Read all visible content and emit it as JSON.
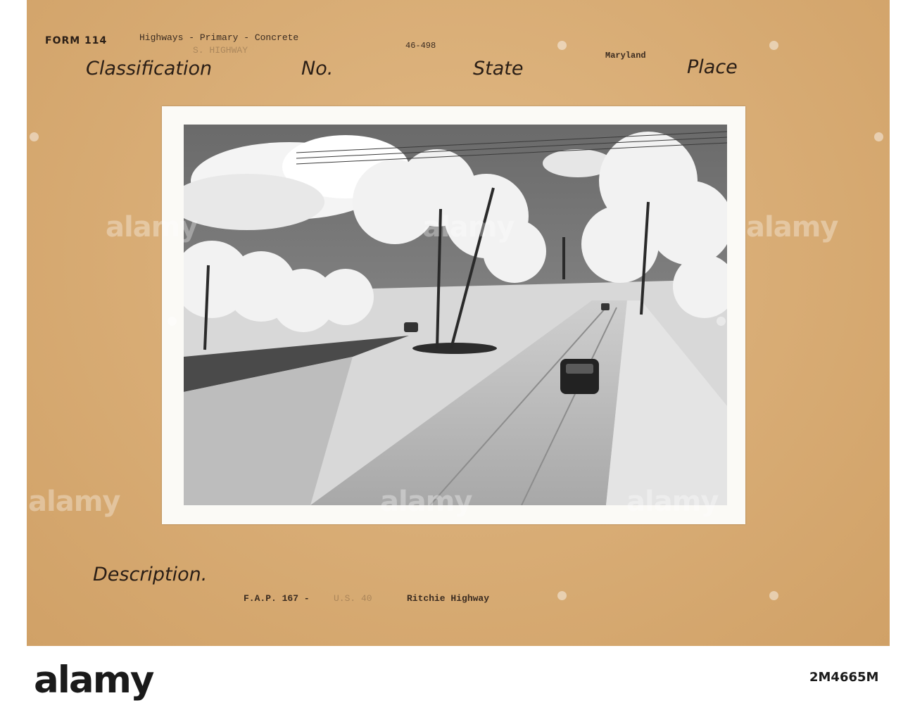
{
  "card": {
    "form_label": "FORM 114",
    "classification_value": "Highways - Primary - Concrete",
    "classification_value_faded": "S. HIGHWAY",
    "number_value": "46-498",
    "state_value": "Maryland",
    "headings": {
      "classification": "Classification",
      "number": "No.",
      "state": "State",
      "place": "Place",
      "description": "Description."
    },
    "description": {
      "part1": "F.A.P. 167 -",
      "part2_faded": "U.S. 40",
      "part3": "Ritchie Highway"
    }
  },
  "watermark": {
    "text": "alamy"
  },
  "footer": {
    "brand": "alamy",
    "image_id": "2M4665M"
  },
  "colors": {
    "card": "#d7a86e",
    "ink": "#2a1e16",
    "mount": "#fbfaf6"
  }
}
